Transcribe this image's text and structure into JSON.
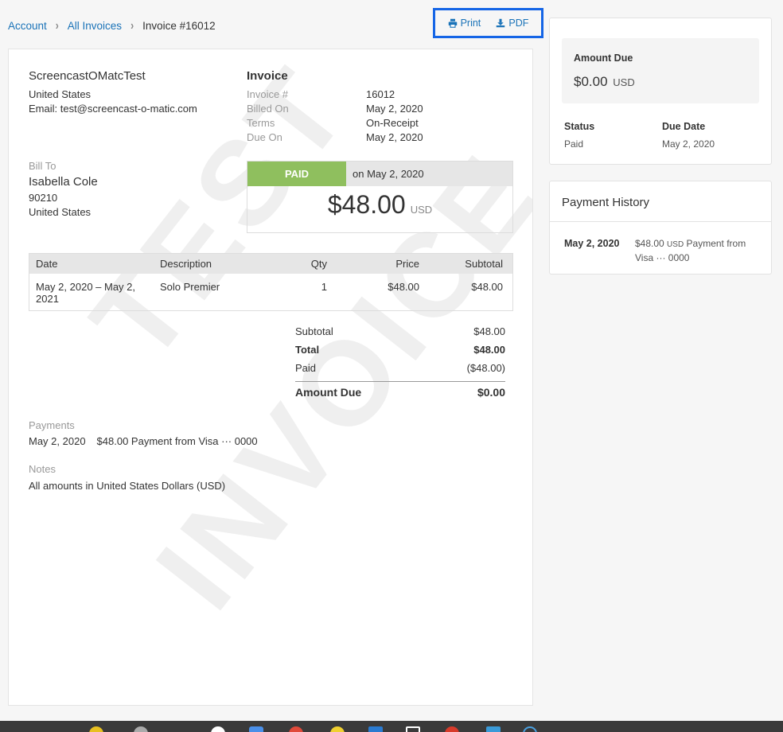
{
  "breadcrumb": {
    "items": [
      "Account",
      "All Invoices"
    ],
    "current": "Invoice #16012"
  },
  "actions": {
    "print_label": "Print",
    "pdf_label": "PDF"
  },
  "watermark": [
    "TEST",
    "INVOICE"
  ],
  "from": {
    "name": "ScreencastOMatcTest",
    "country": "United States",
    "email": "Email: test@screencast-o-matic.com"
  },
  "invoice": {
    "title": "Invoice",
    "fields": [
      {
        "label": "Invoice #",
        "value": "16012"
      },
      {
        "label": "Billed On",
        "value": "May 2, 2020"
      },
      {
        "label": "Terms",
        "value": "On-Receipt"
      },
      {
        "label": "Due On",
        "value": "May 2, 2020"
      }
    ]
  },
  "bill_to": {
    "label": "Bill To",
    "name": "Isabella Cole",
    "zip": "90210",
    "country": "United States"
  },
  "paid": {
    "badge": "PAID",
    "on": "on May 2, 2020",
    "amount": "$48.00",
    "currency": "USD"
  },
  "items": {
    "headers": {
      "date": "Date",
      "desc": "Description",
      "qty": "Qty",
      "price": "Price",
      "subtotal": "Subtotal"
    },
    "rows": [
      {
        "date": "May 2, 2020 – May 2, 2021",
        "desc": "Solo Premier",
        "qty": "1",
        "price": "$48.00",
        "subtotal": "$48.00"
      }
    ]
  },
  "totals": {
    "subtotal_label": "Subtotal",
    "subtotal": "$48.00",
    "total_label": "Total",
    "total": "$48.00",
    "paid_label": "Paid",
    "paid": "($48.00)",
    "due_label": "Amount Due",
    "due": "$0.00"
  },
  "payments": {
    "label": "Payments",
    "date": "May 2, 2020",
    "text": "$48.00 Payment from Visa ··· 0000"
  },
  "notes": {
    "label": "Notes",
    "text": "All amounts in United States Dollars (USD)"
  },
  "summary": {
    "amount_due_label": "Amount Due",
    "amount_due": "$0.00",
    "currency": "USD",
    "status_label": "Status",
    "status": "Paid",
    "due_date_label": "Due Date",
    "due_date": "May 2, 2020"
  },
  "history": {
    "title": "Payment History",
    "date": "May 2, 2020",
    "amount": "$48.00",
    "currency": "USD",
    "text": "Payment from Visa ··· 0000"
  },
  "colors": {
    "link": "#1a73b8",
    "paid_green": "#8fbf5e",
    "highlight_border": "#1565e6"
  }
}
